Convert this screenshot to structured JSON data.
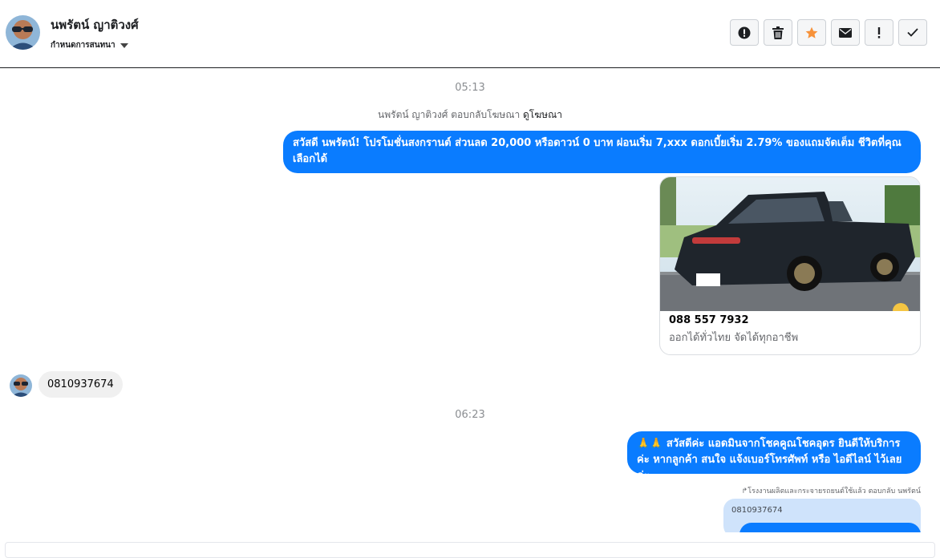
{
  "header": {
    "contact_name": "นพรัตน์ ญาติวงศ์",
    "assign_label": "กำหนดการสนทนา"
  },
  "toolbar": {
    "buttons": [
      {
        "icon": "alert-circle-icon"
      },
      {
        "icon": "trash-icon"
      },
      {
        "icon": "star-icon",
        "color": "#f7923a"
      },
      {
        "icon": "envelope-icon"
      },
      {
        "icon": "exclamation-icon"
      },
      {
        "icon": "checkmark-icon"
      }
    ]
  },
  "thread": {
    "time1": "05:13",
    "reply_info": {
      "text": "นพรัตน์ ญาติวงศ์ ตอบกลับโฆษณา",
      "link": "ดูโฆษณา"
    },
    "promo_message": "สวัสดี นพรัตน์! โปรโมชั่นสงกรานต์ ส่วนลด 20,000 หรือดาวน์ 0 บาท ผ่อนเริ่ม 7,xxx ดอกเบี้ยเริ่ม 2.79% ของแถมจัดเต็ม ชีวิตที่คุณเลือกได้",
    "ad_card": {
      "title": "088 557 7932",
      "subtitle": "ออกได้ทั่วไทย จัดได้ทุกอาชีพ"
    },
    "incoming_message": "0810937674",
    "time2": "06:23",
    "welcome_message": "🙏🙏 สวัสดีค่ะ แอดมินจากโชคคูณโชคอุดร ยินดีให้บริการค่ะ หากลูกค้า สนใจ แจ้งเบอร์โทรศัพท์ หรือ ไอดีไลน์  ไว้เลยค่ะ",
    "reply_label": "↱โรงงานผลิตและกระจายรถยนต์ใช้แล้ว ตอบกลับ นพรัตน์",
    "quoted_text": "0810937674"
  },
  "colors": {
    "outgoing_bubble": "#0a7cff",
    "incoming_bubble": "#f0f0f0",
    "star": "#f7923a"
  }
}
